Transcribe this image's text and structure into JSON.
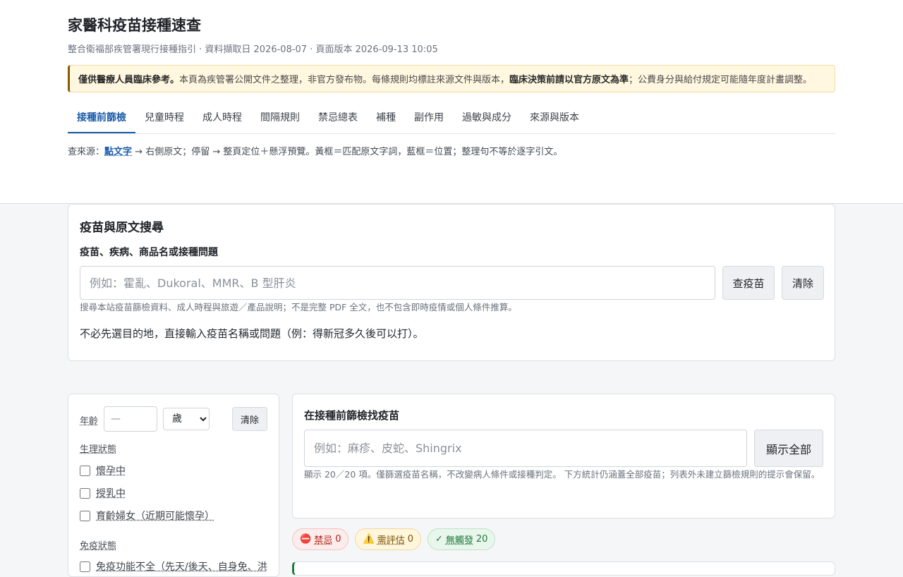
{
  "header": {
    "title": "家醫科疫苗接種速查",
    "subtitle": "整合衛福部疾管署現行接種指引 · 資料擷取日 2026-08-07 · 頁面版本 2026-09-13 10:05",
    "notice": {
      "bold1": "僅供醫療人員臨床參考。",
      "text1": "本頁為疾管署公開文件之整理，非官方發布物。每條規則均標註來源文件與版本，",
      "bold2": "臨床決策前請以官方原文為準",
      "text2": "；公費身分與給付規定可能隨年度計畫調整。"
    },
    "tabs": [
      "接種前篩檢",
      "兒童時程",
      "成人時程",
      "間隔規則",
      "禁忌總表",
      "補種",
      "副作用",
      "過敏與成分",
      "來源與版本"
    ],
    "hint": {
      "prefix": "查來源：",
      "link": "點文字",
      "suffix": " → 右側原文；停留 → 整頁定位＋懸浮預覽。黃框＝匹配原文字詞，藍框＝位置；整理句不等於逐字引文。"
    }
  },
  "search": {
    "heading": "疫苗與原文搜尋",
    "label": "疫苗、疾病、商品名或接種問題",
    "placeholder": "例如：霍亂、Dukoral、MMR、B 型肝炎",
    "submit_label": "查疫苗",
    "clear_label": "清除",
    "note": "搜尋本站疫苗篩檢資料、成人時程與旅遊／產品說明；不是完整 PDF 全文，也不包含即時疫情或個人條件推算。",
    "tip": "不必先選目的地，直接輸入疫苗名稱或問題（例：得新冠多久後可以打）。"
  },
  "filters": {
    "age_label": "年齡",
    "age_placeholder": "—",
    "age_unit": "歲",
    "clear_label": "清除",
    "physio_label": "生理狀態",
    "physio_items": [
      "懷孕中",
      "授乳中",
      "育齡婦女（近期可能懷孕）"
    ],
    "immune_label": "免疫狀態",
    "immune_items": [
      "免疫功能不全（先天/後天、自身免、洪"
    ]
  },
  "screening": {
    "heading": "在接種前篩檢找疫苗",
    "placeholder": "例如：麻疹、皮蛇、Shingrix",
    "show_all_label": "顯示全部",
    "note": "顯示 20／20 項。僅篩選疫苗名稱，不改變病人條件或接種判定。 下方統計仍涵蓋全部疫苗；列表外未建立篩檢規則的提示會保留。"
  },
  "badges": {
    "contra": {
      "icon": "⛔",
      "label": "禁忌",
      "count": "0"
    },
    "assess": {
      "icon": "⚠️",
      "label": "需評估",
      "count": "0"
    },
    "none": {
      "icon": "✓",
      "label": "無觸發",
      "count": "20"
    }
  },
  "colors": {
    "accent": "#1a5aa8",
    "warning_border": "#8a5a00",
    "danger": "#b42318",
    "ok": "#1e7a3a"
  }
}
